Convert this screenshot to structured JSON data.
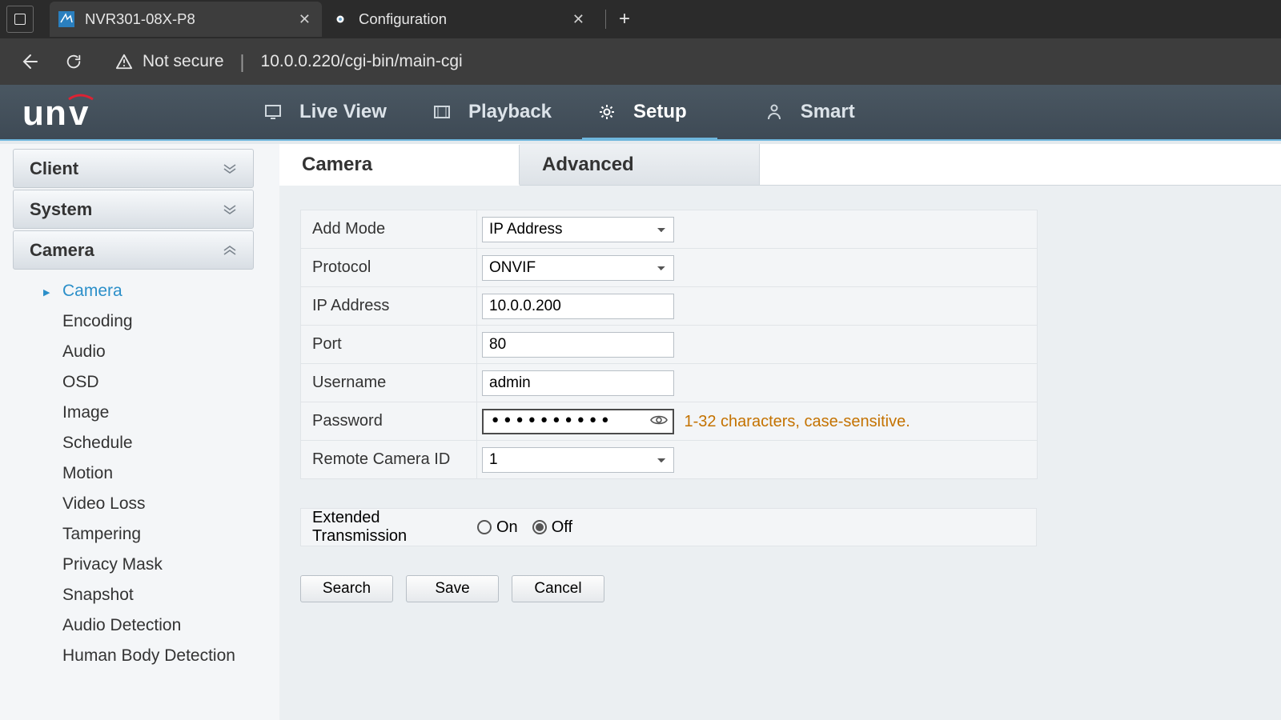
{
  "browser": {
    "tab1_title": "NVR301-08X-P8",
    "tab2_title": "Configuration",
    "not_secure_label": "Not secure",
    "url": "10.0.0.220/cgi-bin/main-cgi"
  },
  "topnav": {
    "live_view": "Live View",
    "playback": "Playback",
    "setup": "Setup",
    "smart": "Smart"
  },
  "sidebar": {
    "client": "Client",
    "system": "System",
    "camera": "Camera",
    "items": [
      "Camera",
      "Encoding",
      "Audio",
      "OSD",
      "Image",
      "Schedule",
      "Motion",
      "Video Loss",
      "Tampering",
      "Privacy Mask",
      "Snapshot",
      "Audio Detection",
      "Human Body Detection"
    ]
  },
  "tabs": {
    "camera": "Camera",
    "advanced": "Advanced"
  },
  "form": {
    "add_mode_label": "Add Mode",
    "add_mode_value": "IP Address",
    "protocol_label": "Protocol",
    "protocol_value": "ONVIF",
    "ip_label": "IP Address",
    "ip_value": "10.0.0.200",
    "port_label": "Port",
    "port_value": "80",
    "username_label": "Username",
    "username_value": "admin",
    "password_label": "Password",
    "password_value": "••••••••••",
    "password_hint": "1-32 characters, case-sensitive.",
    "remote_id_label": "Remote Camera ID",
    "remote_id_value": "1",
    "ext_label": "Extended Transmission",
    "ext_on": "On",
    "ext_off": "Off",
    "ext_selected": "Off"
  },
  "buttons": {
    "search": "Search",
    "save": "Save",
    "cancel": "Cancel"
  }
}
